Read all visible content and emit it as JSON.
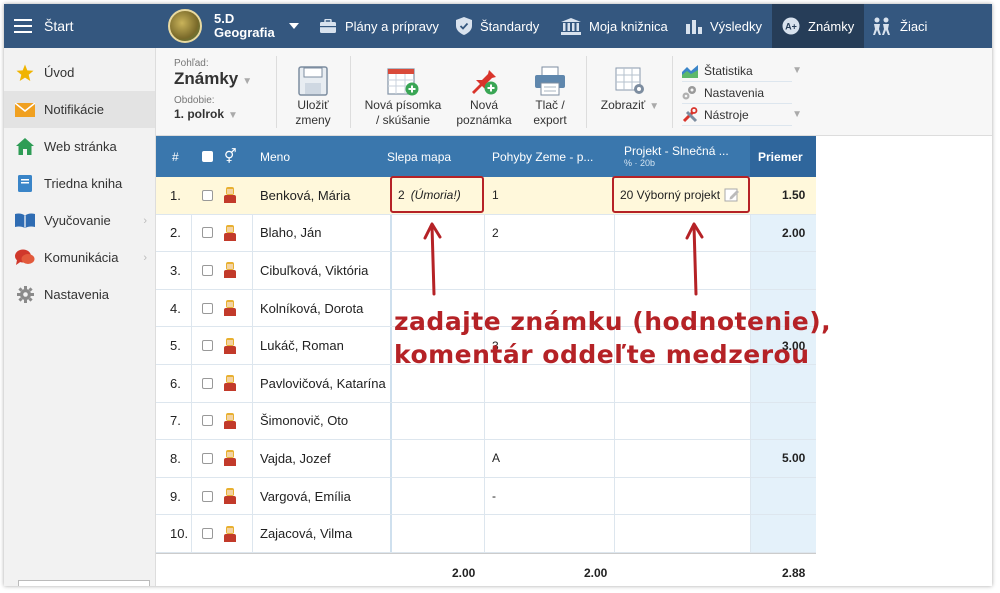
{
  "topbar": {
    "start_label": "Štart",
    "class_name": "5.D",
    "class_subject": "Geografia",
    "nav": [
      {
        "label": "Plány a prípravy",
        "icon": "briefcase-icon"
      },
      {
        "label": "Štandardy",
        "icon": "shield-icon"
      },
      {
        "label": "Moja knižnica",
        "icon": "library-icon"
      },
      {
        "label": "Výsledky",
        "icon": "bar-chart-icon"
      },
      {
        "label": "Známky",
        "icon": "grades-icon",
        "active": true
      },
      {
        "label": "Žiaci",
        "icon": "students-icon"
      }
    ]
  },
  "sidebar": {
    "items": [
      {
        "label": "Úvod",
        "icon": "star-icon"
      },
      {
        "label": "Notifikácie",
        "icon": "envelope-icon",
        "active": true
      },
      {
        "label": "Web stránka",
        "icon": "home-icon"
      },
      {
        "label": "Triedna kniha",
        "icon": "notebook-icon"
      },
      {
        "label": "Vyučovanie",
        "icon": "book-icon",
        "chevron": true
      },
      {
        "label": "Komunikácia",
        "icon": "chat-icon",
        "chevron": true
      },
      {
        "label": "Nastavenia",
        "icon": "gear-icon"
      }
    ]
  },
  "toolbar": {
    "view_caption": "Pohľad:",
    "view_value": "Známky",
    "period_caption": "Obdobie:",
    "period_value": "1. polrok",
    "save_l1": "Uložiť",
    "save_l2": "zmeny",
    "new_exam_l1": "Nová písomka",
    "new_exam_l2": "/ skúšanie",
    "new_note_l1": "Nová",
    "new_note_l2": "poznámka",
    "print_l1": "Tlač /",
    "print_l2": "export",
    "show_label": "Zobraziť",
    "stats_label": "Štatistika",
    "settings_label": "Nastavenia",
    "tools_label": "Nástroje"
  },
  "table": {
    "headers": {
      "num": "#",
      "name": "Meno",
      "col1": "Slepa mapa",
      "col2": "Pohyby Zeme - p...",
      "col3": "Projekt - Slnečná ...",
      "col3_sub": "% · 20b",
      "avg": "Priemer"
    },
    "rows": [
      {
        "num": "1.",
        "name": "Benková, Mária",
        "c1": "2",
        "c1_note": "(Úmoria!)",
        "c2": "1",
        "c3": "20 Výborný projekt",
        "avg": "1.50"
      },
      {
        "num": "2.",
        "name": "Blaho, Ján",
        "c1": "",
        "c2": "2",
        "c3": "",
        "avg": "2.00"
      },
      {
        "num": "3.",
        "name": "Cibuľková, Viktória",
        "c1": "",
        "c2": "",
        "c3": "",
        "avg": ""
      },
      {
        "num": "4.",
        "name": "Kolníková, Dorota",
        "c1": "",
        "c2": "",
        "c3": "",
        "avg": ""
      },
      {
        "num": "5.",
        "name": "Lukáč, Roman",
        "c1": "",
        "c2": "3",
        "c3": "",
        "avg": "3.00"
      },
      {
        "num": "6.",
        "name": "Pavlovičová, Katarína",
        "c1": "",
        "c2": "",
        "c3": "",
        "avg": ""
      },
      {
        "num": "7.",
        "name": "Šimonovič, Oto",
        "c1": "",
        "c2": "",
        "c3": "",
        "avg": ""
      },
      {
        "num": "8.",
        "name": "Vajda, Jozef",
        "c1": "",
        "c2": "A",
        "c3": "",
        "avg": "5.00"
      },
      {
        "num": "9.",
        "name": "Vargová, Emília",
        "c1": "",
        "c2": "-",
        "c3": "",
        "avg": ""
      },
      {
        "num": "10.",
        "name": "Zajacová, Vilma",
        "c1": "",
        "c2": "",
        "c3": "",
        "avg": ""
      }
    ],
    "footer": {
      "c1": "2.00",
      "c2": "2.00",
      "avg": "2.88"
    }
  },
  "annotation": {
    "line1": "zadajte známku (hodnotenie),",
    "line2": "komentár oddeľte medzerou"
  },
  "colors": {
    "topbar": "#34577f",
    "header": "#3a77ad",
    "accent": "#b52226"
  }
}
